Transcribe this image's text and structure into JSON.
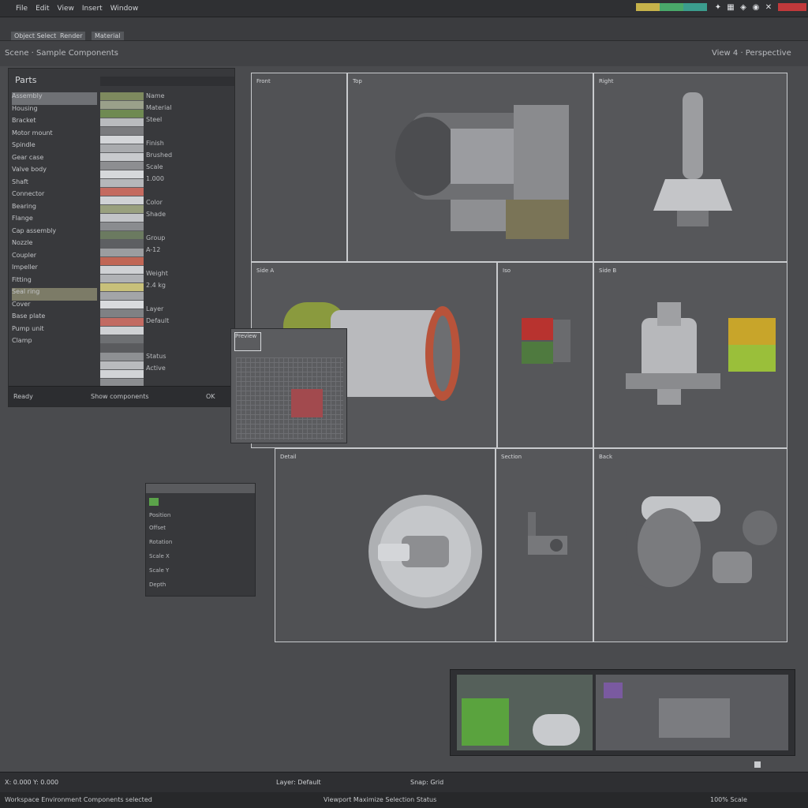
{
  "menu": [
    "File",
    "Edit",
    "View",
    "Insert",
    "Window"
  ],
  "top_icons": [
    "pin-icon",
    "grid-icon",
    "lock-icon",
    "layers-icon",
    "close-icon"
  ],
  "swatches": [
    "#c6b24a",
    "#49a96a",
    "#3b9d8e"
  ],
  "toolbar": {
    "btn1": "Object Select",
    "btn2": "Render",
    "btn3": "Material"
  },
  "title_left": "Scene · Sample Components",
  "title_right": "View 4 · Perspective",
  "left_panel": {
    "header": "Parts",
    "tree": [
      "Assembly",
      "Housing",
      "Bracket",
      "Motor mount",
      "Spindle",
      "Gear case",
      "Valve body",
      "Shaft",
      "Connector",
      "Bearing",
      "Flange",
      "Cap assembly",
      "Nozzle",
      "Coupler",
      "Impeller",
      "Fitting",
      "Seal ring",
      "Cover",
      "Base plate",
      "Pump unit",
      "Clamp"
    ],
    "props": [
      "Name",
      "Material",
      "Steel",
      "",
      "Finish",
      "Brushed",
      "Scale",
      "1.000",
      "",
      "Color",
      "Shade",
      "",
      "Group",
      "A-12",
      "",
      "Weight",
      "2.4 kg",
      "",
      "Layer",
      "Default",
      "",
      "",
      "Status",
      "Active"
    ],
    "footer_a": "Ready",
    "footer_b": "Show components",
    "footer_c": "OK"
  },
  "small_panel": {
    "rows": [
      "Position",
      "Offset",
      "Rotation",
      "Scale X",
      "Scale Y",
      "Depth"
    ]
  },
  "preview_label": "Preview",
  "cells": {
    "c1": "Front",
    "c2": "Top",
    "c3": "Right",
    "c4": "Side A",
    "c5": "Iso",
    "c6": "Side B",
    "c7": "Detail",
    "c8": "Section",
    "c9": "Back"
  },
  "status_left": "X: 0.000 Y: 0.000",
  "status_mid": "Layer: Default",
  "status_right": "Snap: Grid",
  "bottom_left": "Workspace Environment  Components selected",
  "bottom_mid": "Viewport  Maximize Selection  Status",
  "bottom_right": "100%  Scale"
}
